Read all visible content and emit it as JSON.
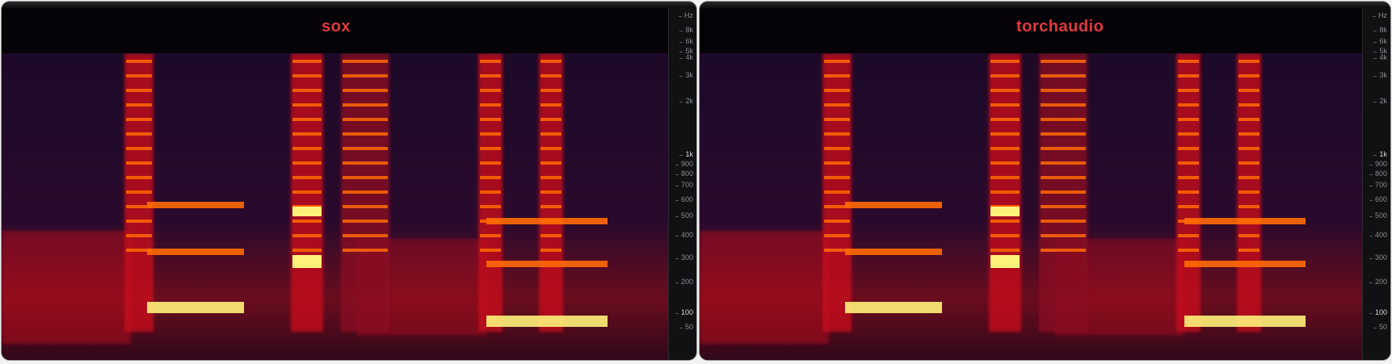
{
  "panels": [
    {
      "title": "sox",
      "topbar_text": "",
      "scale_labels": [
        {
          "label": "Hz",
          "major": false
        },
        {
          "label": "8k",
          "major": false
        },
        {
          "label": "6k",
          "major": false
        },
        {
          "label": "5k",
          "major": false
        },
        {
          "label": "4k",
          "major": false
        },
        {
          "label": "3k",
          "major": false
        },
        {
          "label": "2k",
          "major": false
        },
        {
          "label": "1k",
          "major": true
        },
        {
          "label": "900",
          "major": false
        },
        {
          "label": "800",
          "major": false
        },
        {
          "label": "700",
          "major": false
        },
        {
          "label": "600",
          "major": false
        },
        {
          "label": "500",
          "major": false
        },
        {
          "label": "400",
          "major": false
        },
        {
          "label": "300",
          "major": false
        },
        {
          "label": "200",
          "major": false
        },
        {
          "label": "100",
          "major": true
        },
        {
          "label": "50",
          "major": false
        }
      ]
    },
    {
      "title": "torchaudio",
      "topbar_text": "",
      "scale_labels": [
        {
          "label": "Hz",
          "major": false
        },
        {
          "label": "8k",
          "major": false
        },
        {
          "label": "6k",
          "major": false
        },
        {
          "label": "5k",
          "major": false
        },
        {
          "label": "4k",
          "major": false
        },
        {
          "label": "3k",
          "major": false
        },
        {
          "label": "2k",
          "major": false
        },
        {
          "label": "1k",
          "major": true
        },
        {
          "label": "900",
          "major": false
        },
        {
          "label": "800",
          "major": false
        },
        {
          "label": "700",
          "major": false
        },
        {
          "label": "600",
          "major": false
        },
        {
          "label": "500",
          "major": false
        },
        {
          "label": "400",
          "major": false
        },
        {
          "label": "300",
          "major": false
        },
        {
          "label": "200",
          "major": false
        },
        {
          "label": "100",
          "major": true
        },
        {
          "label": "50",
          "major": false
        }
      ]
    }
  ],
  "colors": {
    "title": "#e0383e",
    "background": "#0e0614",
    "hot": "#fff27a",
    "warm": "#ff6a00",
    "mid": "#c8101e",
    "cool": "#5a0d3c"
  }
}
